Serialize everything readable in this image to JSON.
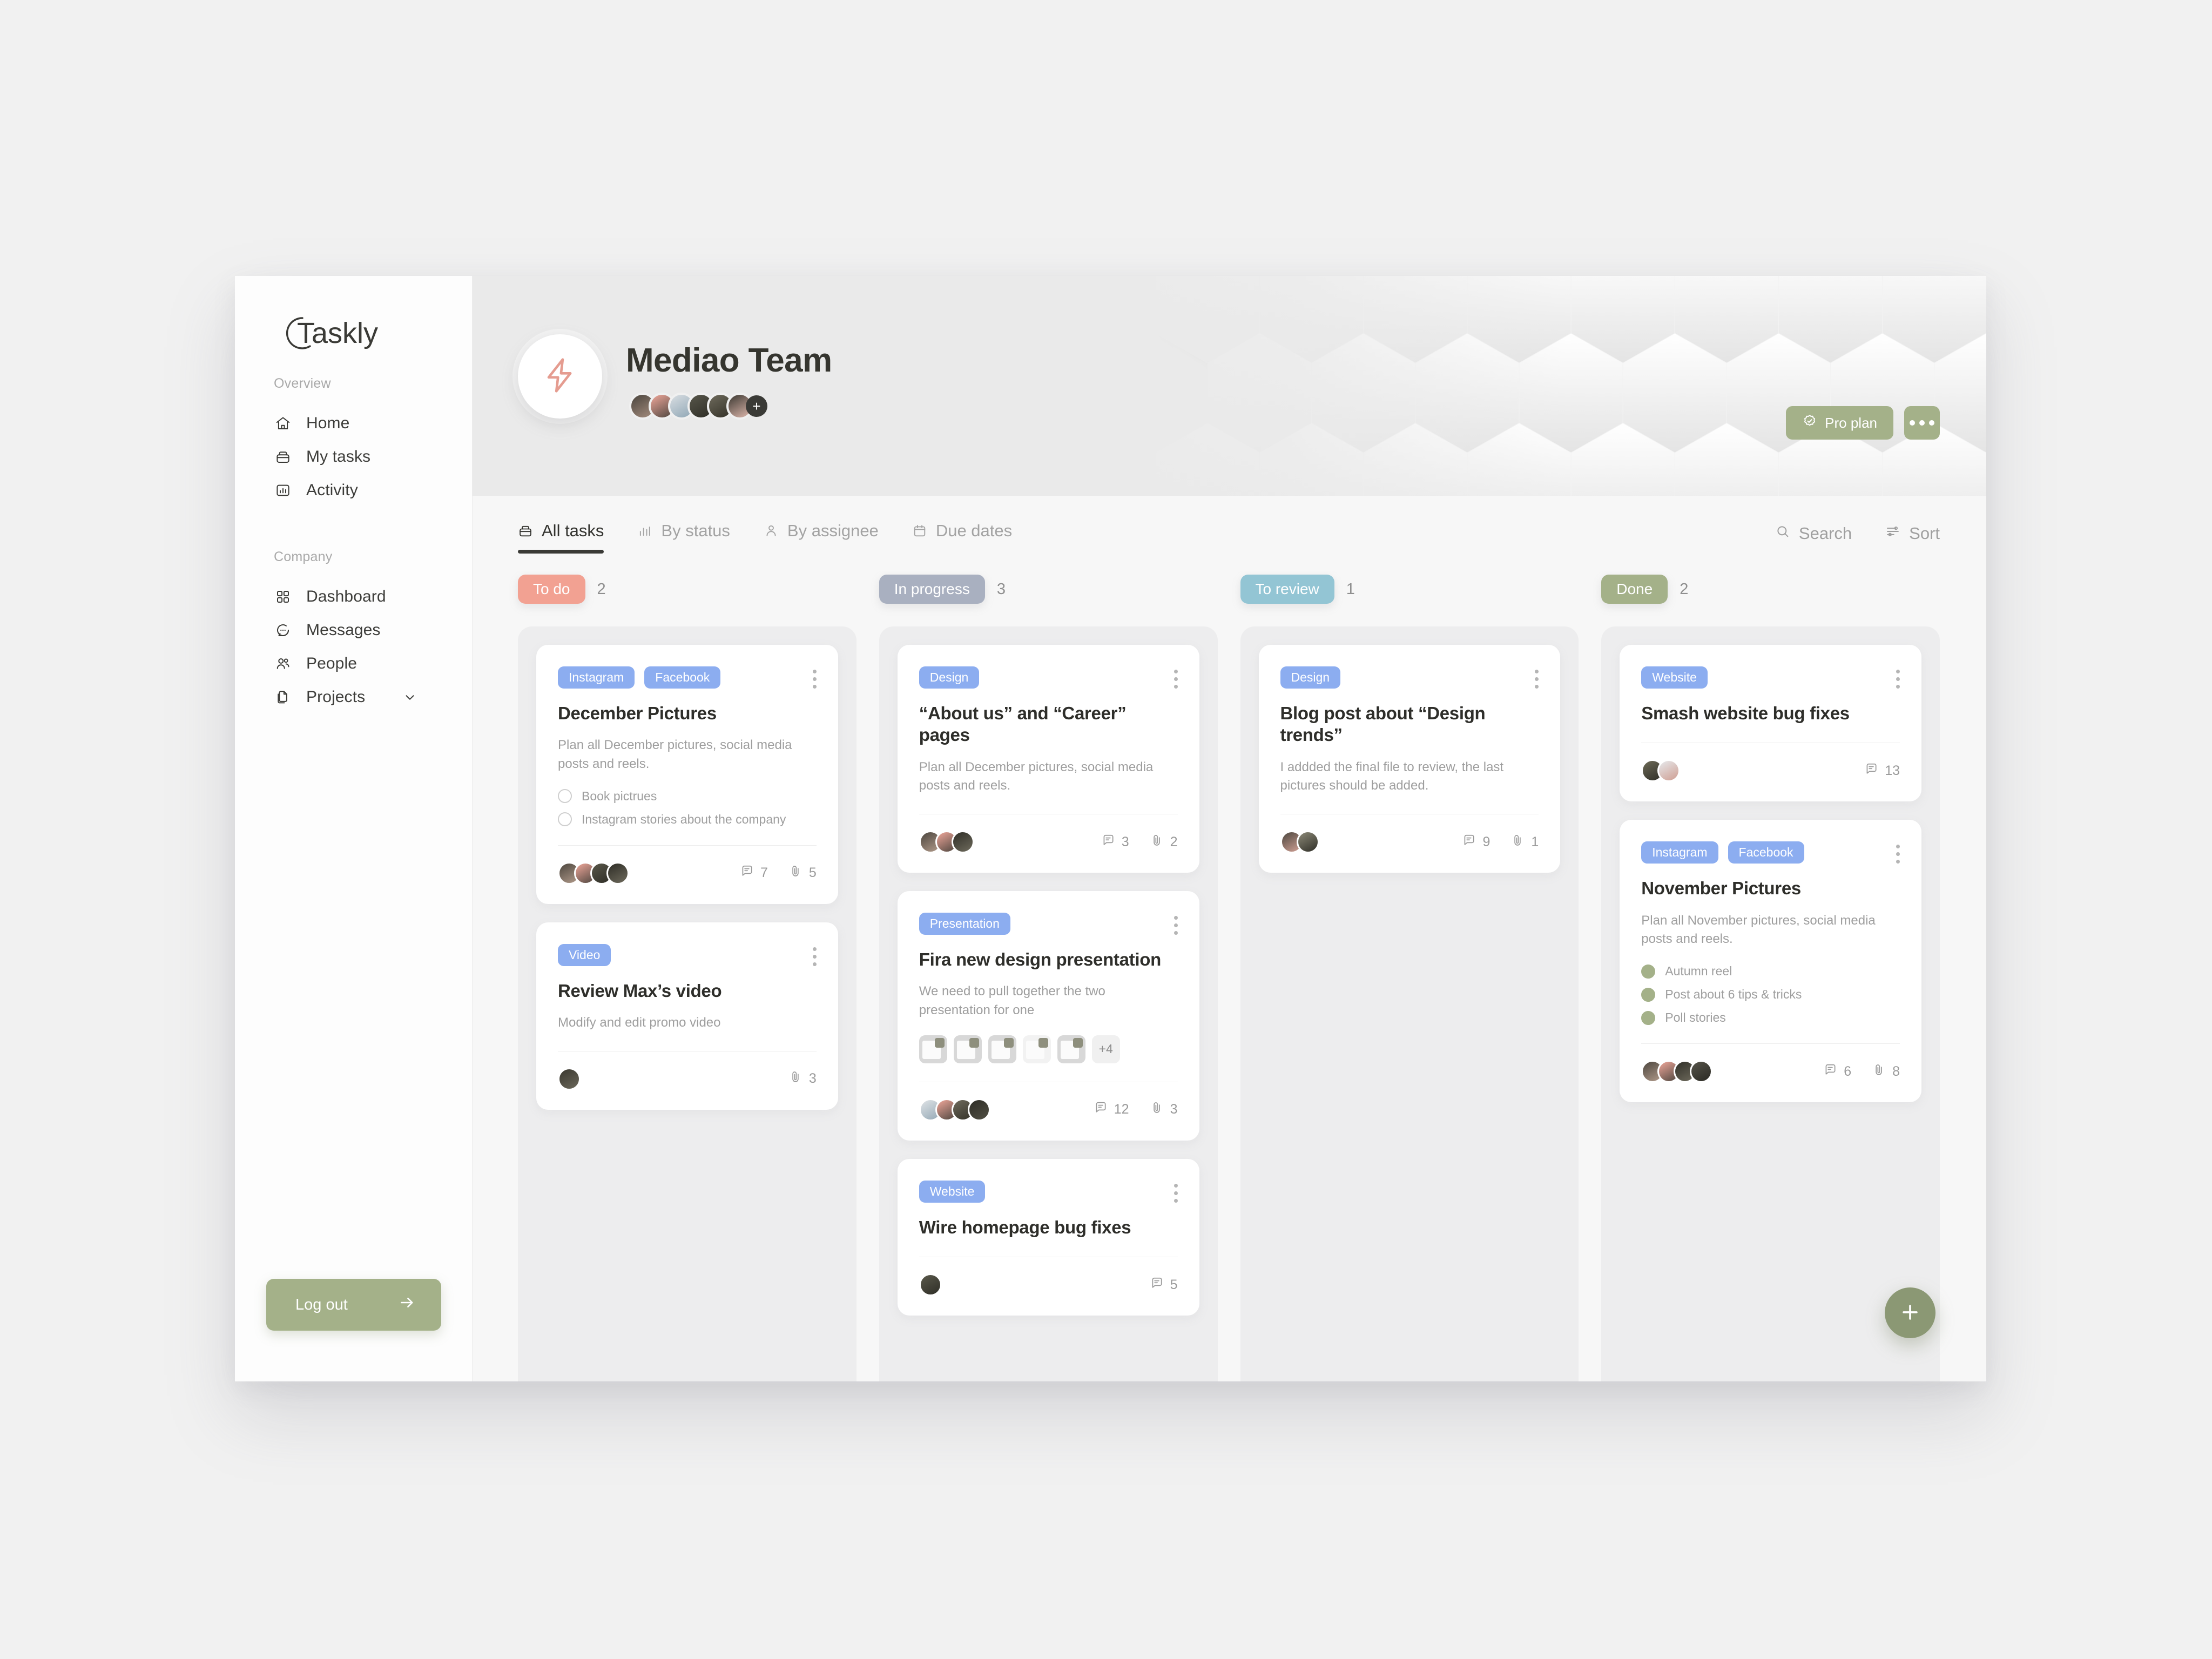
{
  "brand": {
    "name": "Taskly"
  },
  "sidebar": {
    "sections": [
      {
        "label": "Overview",
        "items": [
          {
            "label": "Home",
            "icon": "home-icon"
          },
          {
            "label": "My tasks",
            "icon": "inbox-icon"
          },
          {
            "label": "Activity",
            "icon": "chart-icon"
          }
        ]
      },
      {
        "label": "Company",
        "items": [
          {
            "label": "Dashboard",
            "icon": "grid-icon"
          },
          {
            "label": "Messages",
            "icon": "chat-icon"
          },
          {
            "label": "People",
            "icon": "people-icon"
          },
          {
            "label": "Projects",
            "icon": "files-icon",
            "expandable": true
          }
        ]
      }
    ],
    "logout": {
      "label": "Log out",
      "icon": "arrow-right-icon"
    }
  },
  "header": {
    "team_name": "Mediao Team",
    "team_icon": "lightning-bolt-icon",
    "member_count_more": "+",
    "pro_plan": {
      "label": "Pro plan",
      "icon": "verified-badge-icon"
    },
    "more_label": "…"
  },
  "toolbar": {
    "tabs": [
      {
        "label": "All tasks",
        "icon": "inbox-icon",
        "active": true
      },
      {
        "label": "By status",
        "icon": "chart-icon",
        "active": false
      },
      {
        "label": "By assignee",
        "icon": "person-icon",
        "active": false
      },
      {
        "label": "Due dates",
        "icon": "calendar-icon",
        "active": false
      }
    ],
    "search_label": "Search",
    "sort_label": "Sort"
  },
  "board": {
    "columns": [
      {
        "title": "To do",
        "count": "2",
        "color": "#f2a192",
        "cards": [
          {
            "tags": [
              "Instagram",
              "Facebook"
            ],
            "title": "December Pictures",
            "desc": "Plan all December pictures, social media posts and reels.",
            "subtasks": [
              {
                "label": "Book pictrues",
                "done": false
              },
              {
                "label": "Instagram stories about the company",
                "done": false
              }
            ],
            "avatars": 4,
            "comments": "7",
            "attachments": "5"
          },
          {
            "tags": [
              "Video"
            ],
            "title": "Review Max’s video",
            "desc": "Modify and edit promo video",
            "subtasks": [],
            "avatars": 1,
            "comments": null,
            "attachments": "3"
          }
        ]
      },
      {
        "title": "In progress",
        "count": "3",
        "color": "#a9b0c0",
        "cards": [
          {
            "tags": [
              "Design"
            ],
            "title": "“About us” and “Career” pages",
            "desc": "Plan all December pictures, social media posts and reels.",
            "subtasks": [],
            "avatars": 3,
            "comments": "3",
            "attachments": "2"
          },
          {
            "tags": [
              "Presentation"
            ],
            "title": "Fira new design presentation",
            "desc": "We need to pull together the two presentation for one",
            "subtasks": [],
            "thumbnails": 5,
            "thumbnails_more": "+4",
            "avatars": 4,
            "comments": "12",
            "attachments": "3"
          },
          {
            "tags": [
              "Website"
            ],
            "title": "Wire homepage bug fixes",
            "desc": null,
            "subtasks": [],
            "avatars": 1,
            "comments": "5",
            "attachments": null
          }
        ]
      },
      {
        "title": "To review",
        "count": "1",
        "color": "#93c5d4",
        "cards": [
          {
            "tags": [
              "Design"
            ],
            "title": "Blog post about “Design trends”",
            "desc": "I addded the final file to review, the last pictures should be added.",
            "subtasks": [],
            "avatars": 2,
            "comments": "9",
            "attachments": "1"
          }
        ]
      },
      {
        "title": "Done",
        "count": "2",
        "color": "#a4b189",
        "cards": [
          {
            "tags": [
              "Website"
            ],
            "title": "Smash website bug fixes",
            "desc": null,
            "subtasks": [],
            "avatars": 2,
            "comments": "13",
            "attachments": null
          },
          {
            "tags": [
              "Instagram",
              "Facebook"
            ],
            "title": "November Pictures",
            "desc": "Plan all November pictures, social media posts and reels.",
            "subtasks": [
              {
                "label": "Autumn reel",
                "done": true
              },
              {
                "label": "Post about 6 tips & tricks",
                "done": true
              },
              {
                "label": "Poll stories",
                "done": true
              }
            ],
            "avatars": 4,
            "comments": "6",
            "attachments": "8"
          }
        ]
      }
    ]
  },
  "fab": {
    "icon": "plus-icon"
  },
  "colors": {
    "accent_green": "#a4b189",
    "tag_blue": "#8cadf0",
    "todo": "#f2a192",
    "in_progress": "#a9b0c0",
    "to_review": "#93c5d4",
    "done": "#a4b189"
  }
}
